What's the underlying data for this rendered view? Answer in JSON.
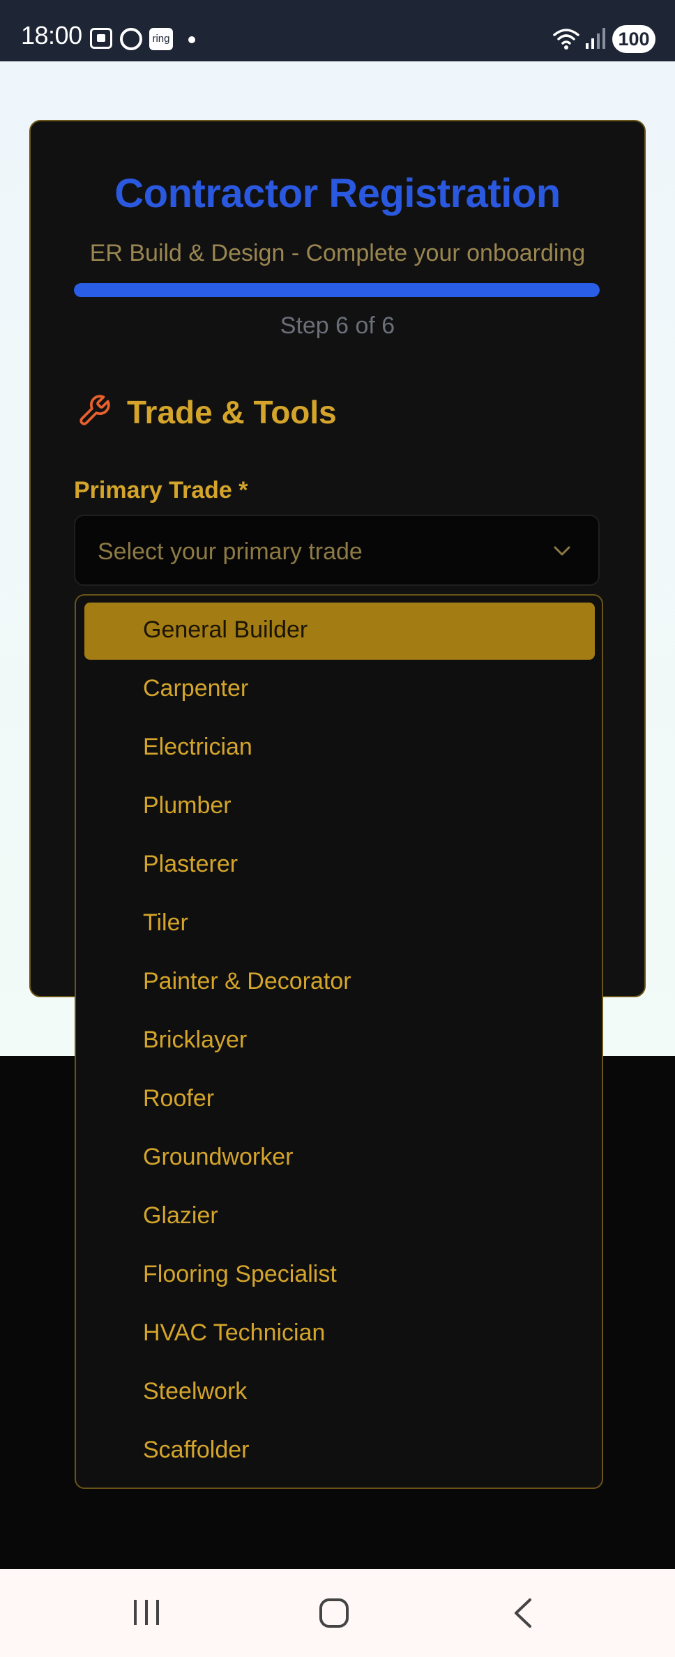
{
  "status_bar": {
    "time": "18:00",
    "ring_label": "ring",
    "battery": "100",
    "icons": [
      "screenshot-icon",
      "circle-icon",
      "ring-app-icon",
      "notification-dot-icon",
      "wifi-icon",
      "signal-icon",
      "battery-icon"
    ]
  },
  "card": {
    "title": "Contractor Registration",
    "subtitle": "ER Build & Design - Complete your onboarding",
    "progress_fraction": 1.0,
    "step_text": "Step 6 of 6"
  },
  "section": {
    "title": "Trade & Tools",
    "icon": "wrench-icon"
  },
  "primary_trade": {
    "label": "Primary Trade *",
    "placeholder": "Select your primary trade"
  },
  "dropdown": {
    "selected_index": 0,
    "options": [
      "General Builder",
      "Carpenter",
      "Electrician",
      "Plumber",
      "Plasterer",
      "Tiler",
      "Painter & Decorator",
      "Bricklayer",
      "Roofer",
      "Groundworker",
      "Glazier",
      "Flooring Specialist",
      "HVAC Technician",
      "Steelwork",
      "Scaffolder"
    ]
  },
  "nav_bar": {
    "icons": [
      "recents-icon",
      "home-icon",
      "back-icon"
    ]
  },
  "colors": {
    "accent_gold": "#d4a52a",
    "title_blue": "#2a59e0",
    "progress_blue": "#2a5ee6",
    "selected_option_bg": "#a37c13",
    "card_bg": "#111112"
  }
}
